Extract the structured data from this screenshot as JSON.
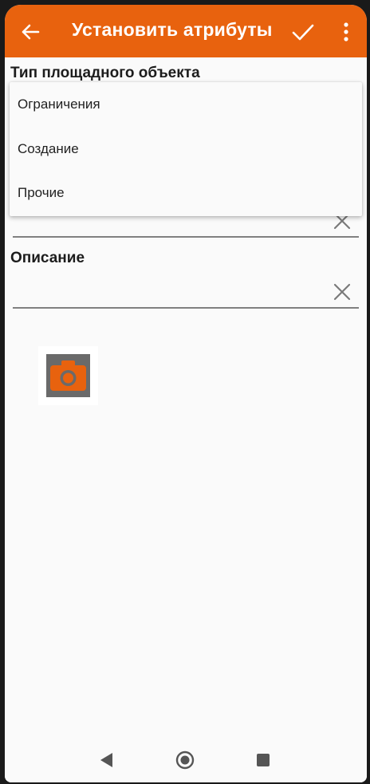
{
  "app_bar": {
    "title": "Установить атрибуты",
    "accent_color": "#e8620e"
  },
  "form": {
    "type_field": {
      "label": "Тип площадного объекта",
      "selected_value": ""
    },
    "description_field": {
      "label": "Описание",
      "value": ""
    }
  },
  "dropdown": {
    "options": [
      "Ограничения",
      "Создание",
      "Прочие"
    ]
  },
  "attachments": {
    "photo_button_icon": "camera-icon"
  },
  "system_nav": {
    "icons": [
      "back-triangle-icon",
      "home-circle-icon",
      "recents-square-icon"
    ]
  }
}
